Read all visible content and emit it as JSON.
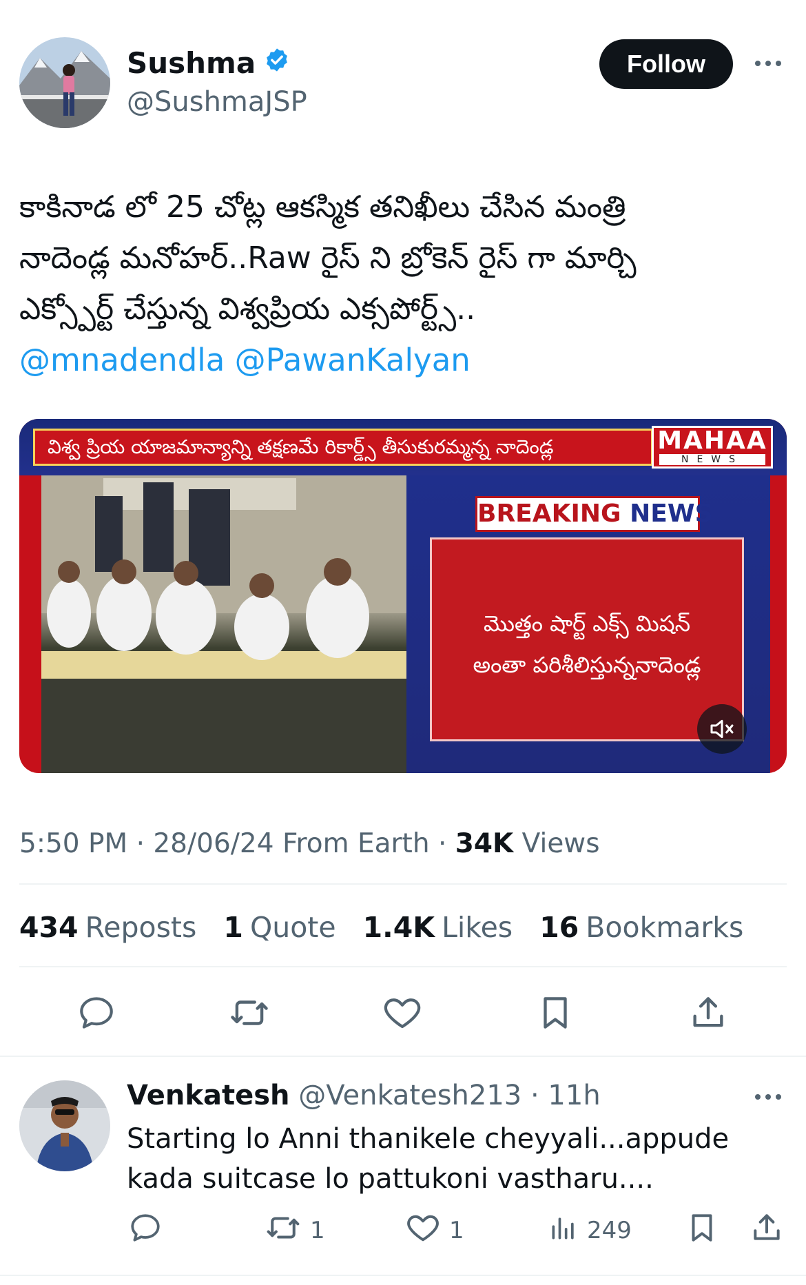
{
  "author": {
    "name": "Sushma",
    "handle": "@SushmaJSP",
    "verified": true,
    "follow_label": "Follow"
  },
  "tweet": {
    "text_lines": [
      "కాకినాడ లో 25 చోట్ల ఆకస్మిక తనిఖీలు చేసిన మంత్రి",
      "నాదెండ్ల మనోహర్..Raw  రైస్ ని బ్రోకెన్ రైస్ గా మార్చి",
      "ఎక్స్పోర్ట్ చేస్తున్న విశ్వప్రియ ఎక్సపోర్ట్స్.."
    ],
    "mention_1": "@mnadendla",
    "mention_2": "@PawanKalyan"
  },
  "video": {
    "banner_text": "విశ్వ ప్రియ యాజమాన్యాన్ని తక్షణమే రికార్డ్స్ తీసుకురమ్మన్న నాదెండ్ల",
    "channel_name": "MAHAA",
    "channel_sub": "NEWS",
    "breaking_1": "BREAKING",
    "breaking_2": "NEWS",
    "box_line_1": "మొత్తం షార్ట్ ఎక్స్ మిషన్",
    "box_line_2": "అంతా పరిశీలిస్తున్ననాదెండ్ల"
  },
  "meta": {
    "time": "5:50 PM",
    "date": "28/06/24",
    "source": "From Earth",
    "views_count": "34K",
    "views_label": "Views"
  },
  "stats": {
    "reposts_count": "434",
    "reposts_label": "Reposts",
    "quotes_count": "1",
    "quotes_label": "Quote",
    "likes_count": "1.4K",
    "likes_label": "Likes",
    "bookmarks_count": "16",
    "bookmarks_label": "Bookmarks"
  },
  "reply": {
    "name": "Venkatesh",
    "handle": "@Venkatesh213",
    "time": "11h",
    "text_lines": [
      "Starting lo Anni thanikele cheyyali...appude",
      "kada suitcase lo pattukoni vastharu...."
    ],
    "reposts": "1",
    "likes": "1",
    "views": "249"
  },
  "icons": {
    "verified": "verified-badge-icon",
    "more": "more-dots-icon",
    "reply": "reply-icon",
    "repost": "repost-icon",
    "like": "heart-icon",
    "bookmark": "bookmark-icon",
    "share": "share-icon",
    "views": "views-icon",
    "mute": "mute-icon"
  },
  "colors": {
    "link": "#1d9bf0",
    "secondary_text": "#536471",
    "verified": "#1d9bf0",
    "follow_bg": "#0f1419"
  }
}
